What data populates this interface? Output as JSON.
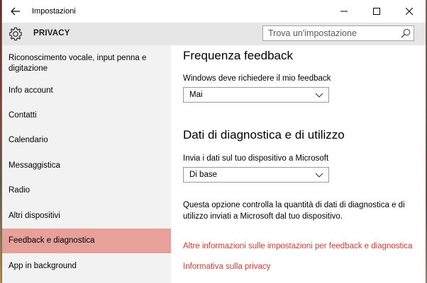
{
  "window": {
    "title": "Impostazioni"
  },
  "header": {
    "title": "PRIVACY"
  },
  "search": {
    "placeholder": "Trova un'impostazione"
  },
  "sidebar": {
    "items": [
      {
        "label": "Riconoscimento vocale, input penna e digitazione",
        "active": false
      },
      {
        "label": "Info account",
        "active": false
      },
      {
        "label": "Contatti",
        "active": false
      },
      {
        "label": "Calendario",
        "active": false
      },
      {
        "label": "Messaggistica",
        "active": false
      },
      {
        "label": "Radio",
        "active": false
      },
      {
        "label": "Altri dispositivi",
        "active": false
      },
      {
        "label": "Feedback e diagnostica",
        "active": true
      },
      {
        "label": "App in background",
        "active": false
      }
    ]
  },
  "main": {
    "feedback": {
      "heading": "Frequenza feedback",
      "label": "Windows deve richiedere il mio feedback",
      "value": "Mai"
    },
    "diagnostics": {
      "heading": "Dati di diagnostica e di utilizzo",
      "label": "Invia i dati sul tuo dispositivo a Microsoft",
      "value": "Di base",
      "description": "Questa opzione controlla la quantità di dati di diagnostica e di utilizzo inviati a Microsoft dal tuo dispositivo."
    },
    "links": {
      "more_info": "Altre informazioni sulle impostazioni per feedback e diagnostica",
      "privacy": "Informativa sulla privacy"
    }
  },
  "colors": {
    "accent": "#d53b34",
    "selected": "#e8a09b",
    "sidebar_bg": "#f2f2f2",
    "header_bg": "#e6e6e6"
  }
}
